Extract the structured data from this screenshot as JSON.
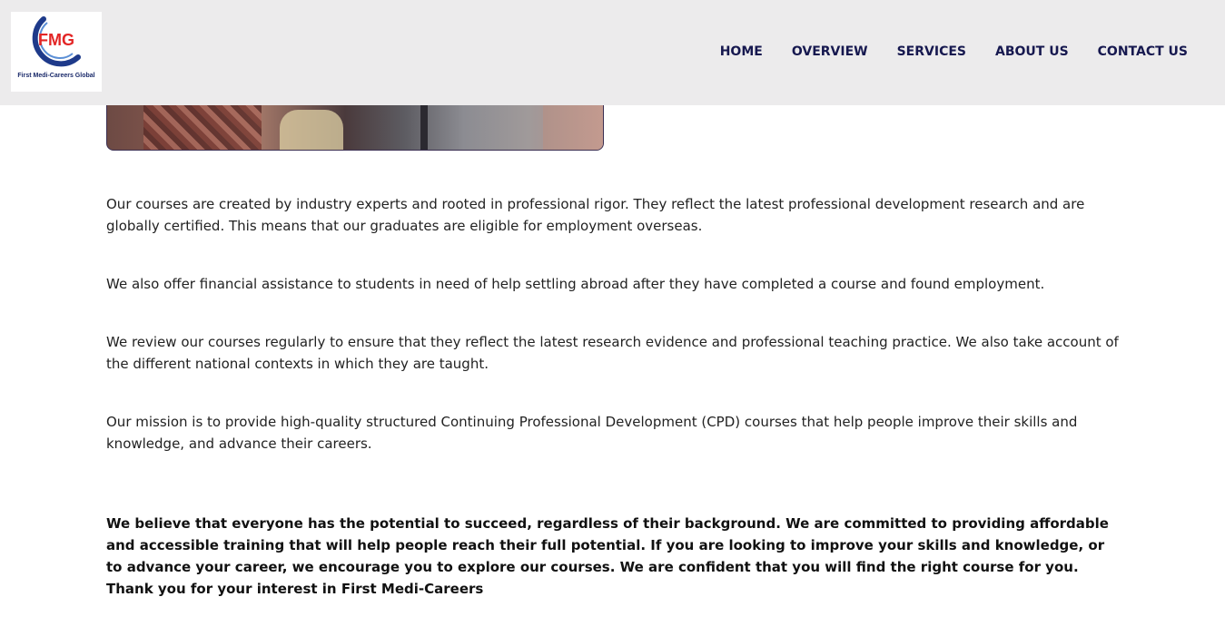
{
  "header": {
    "logo": {
      "mark": "FMG",
      "subtitle": "First Medi-Careers Global",
      "colors": {
        "ring": "#1e3a8a",
        "mark": "#e32626"
      }
    },
    "nav": [
      {
        "label": "HOME"
      },
      {
        "label": "OVERVIEW"
      },
      {
        "label": "SERVICES"
      },
      {
        "label": "ABOUT US"
      },
      {
        "label": "CONTACT US"
      }
    ]
  },
  "main": {
    "paragraphs": [
      "Our courses are created by industry experts and rooted in professional rigor. They reflect the latest professional development research and are globally certified. This means that our graduates are eligible for employment overseas.",
      "We also offer financial assistance to students in need of help settling abroad after they have completed a course and found employment.",
      "We review our courses regularly to ensure that they reflect the latest research evidence and professional teaching practice. We also take account of the different national contexts in which they are taught.",
      "Our mission is to provide high-quality structured Continuing Professional Development (CPD) courses that help people improve their skills and knowledge, and advance their careers."
    ],
    "bold_paragraph": "We believe that everyone has the potential to succeed, regardless of their background. We are committed to providing affordable and accessible training that will help people reach their full potential. If you are looking to improve your skills and knowledge, or to advance your career, we encourage you to explore our courses. We are confident that you will find the right course for you. Thank you for your interest in First Medi-Careers"
  },
  "colors": {
    "header_bg": "#ecebec",
    "nav_text": "#16184f",
    "body_text": "#222222"
  }
}
